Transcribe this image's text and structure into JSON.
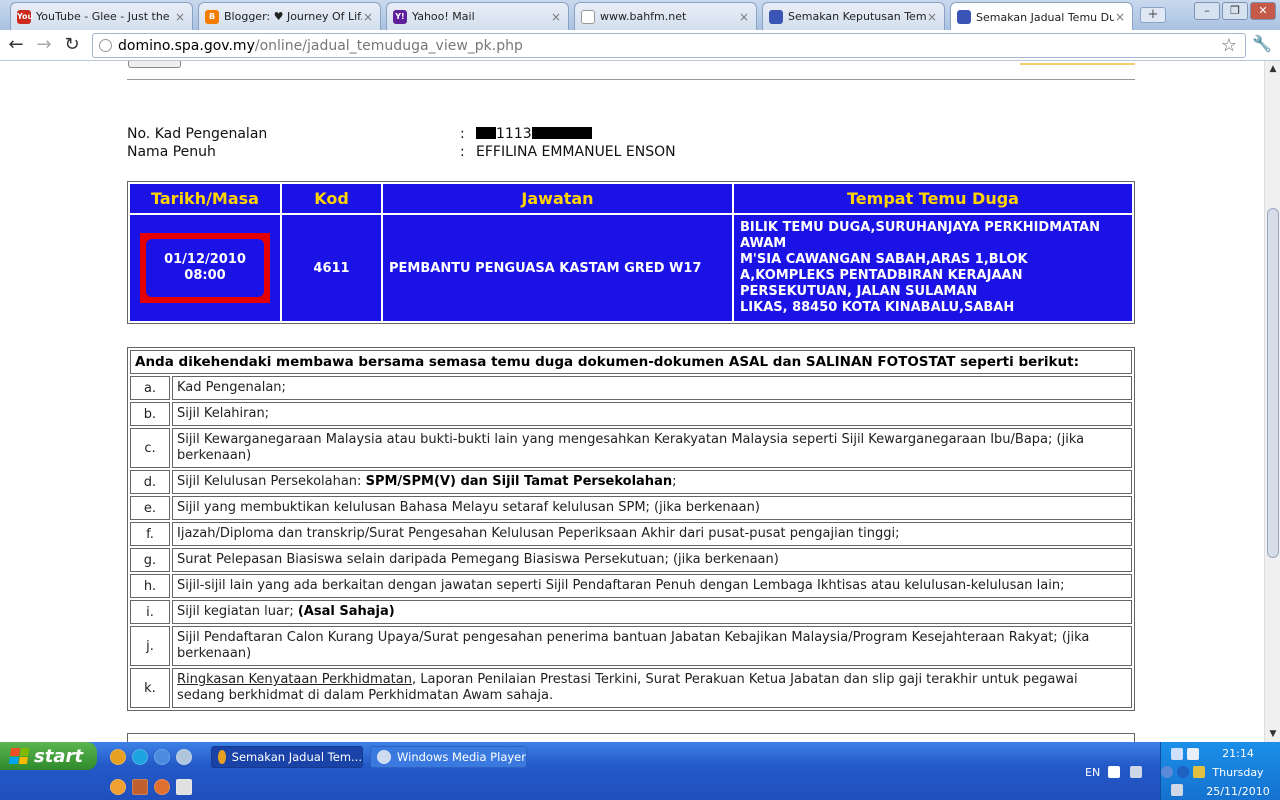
{
  "browser": {
    "tabs": [
      {
        "title": "YouTube - Glee - Just the ...",
        "fav": "You",
        "color": "#cc2a1e",
        "active": false
      },
      {
        "title": "Blogger: ♥ Journey Of Lif...",
        "fav": "B",
        "color": "#f57c00",
        "active": false
      },
      {
        "title": "Yahoo! Mail",
        "fav": "Y!",
        "color": "#5f1f9a",
        "active": false
      },
      {
        "title": "www.bahfm.net",
        "fav": "",
        "color": "#ffffff",
        "active": false
      },
      {
        "title": "Semakan Keputusan Tem...",
        "fav": "",
        "color": "#3a55b5",
        "active": false
      },
      {
        "title": "Semakan Jadual Temu Duga",
        "fav": "",
        "color": "#3a55b5",
        "active": true
      }
    ],
    "url_domain": "domino.spa.gov.my",
    "url_path": "/online/jadual_temuduga_view_pk.php",
    "icons": {
      "back": "back-arrow-icon",
      "forward": "forward-arrow-icon",
      "reload": "reload-icon",
      "star": "bookmark-star-icon",
      "wrench": "wrench-icon"
    }
  },
  "candidate": {
    "ic_label": "No. Kad Pengenalan",
    "ic_value": "1113",
    "name_label": "Nama Penuh",
    "name_value": "EFFILINA EMMANUEL ENSON",
    "colon": ":"
  },
  "schedule": {
    "headers": [
      "Tarikh/Masa",
      "Kod",
      "Jawatan",
      "Tempat Temu Duga"
    ],
    "date": "01/12/2010",
    "time": "08:00",
    "kod": "4611",
    "jawatan": "PEMBANTU PENGUASA KASTAM GRED W17",
    "tempat_lines": [
      "BILIK TEMU DUGA,SURUHANJAYA PERKHIDMATAN AWAM",
      "M'SIA CAWANGAN SABAH,ARAS 1,BLOK A,KOMPLEKS PENTADBIRAN KERAJAAN PERSEKUTUAN, JALAN SULAMAN",
      "LIKAS, 88450 KOTA KINABALU,SABAH"
    ]
  },
  "documents": {
    "header": "Anda dikehendaki membawa bersama semasa temu duga dokumen-dokumen ASAL dan SALINAN FOTOSTAT seperti berikut:",
    "items": [
      {
        "letter": "a.",
        "text": "Kad Pengenalan;"
      },
      {
        "letter": "b.",
        "text": "Sijil Kelahiran;"
      },
      {
        "letter": "c.",
        "text": "Sijil Kewarganegaraan Malaysia atau bukti-bukti lain yang mengesahkan Kerakyatan Malaysia seperti Sijil Kewarganegaraan Ibu/Bapa; (jika berkenaan)"
      },
      {
        "letter": "d.",
        "text": "Sijil Kelulusan Persekolahan: ",
        "bold": "SPM/SPM(V) dan Sijil Tamat Persekolahan",
        "after": ";"
      },
      {
        "letter": "e.",
        "text": "Sijil yang membuktikan kelulusan Bahasa Melayu setaraf kelulusan SPM; (jika berkenaan)"
      },
      {
        "letter": "f.",
        "text": "Ijazah/Diploma dan transkrip/Surat Pengesahan Kelulusan Peperiksaan Akhir dari pusat-pusat pengajian tinggi;"
      },
      {
        "letter": "g.",
        "text": "Surat Pelepasan Biasiswa selain daripada Pemegang Biasiswa Persekutuan; (jika berkenaan)"
      },
      {
        "letter": "h.",
        "text": "Sijil-sijil lain yang ada berkaitan dengan jawatan seperti Sijil Pendaftaran Penuh dengan Lembaga Ikhtisas atau kelulusan-kelulusan lain;"
      },
      {
        "letter": "i.",
        "text": "Sijil kegiatan luar; ",
        "bold": "(Asal Sahaja)",
        "after": ""
      },
      {
        "letter": "j.",
        "text": "Sijil Pendaftaran Calon Kurang Upaya/Surat pengesahan penerima bantuan Jabatan Kebajikan Malaysia/Program Kesejahteraan Rakyat; (jika berkenaan)"
      },
      {
        "letter": "k.",
        "underline": "Ringkasan Kenyataan Perkhidmatan",
        "text": ", Laporan Penilaian Prestasi Terkini, Surat Perakuan Ketua Jabatan dan slip gaji terakhir untuk pegawai sedang berkhidmat di dalam Perkhidmatan Awam sahaja."
      }
    ]
  },
  "taskbar": {
    "start_label": "start",
    "tasks": [
      {
        "label": "Semakan Jadual Tem...",
        "active": true
      },
      {
        "label": "Windows Media Player",
        "active": false
      }
    ],
    "lang": "EN",
    "time": "21:14",
    "day": "Thursday",
    "date": "25/11/2010"
  }
}
